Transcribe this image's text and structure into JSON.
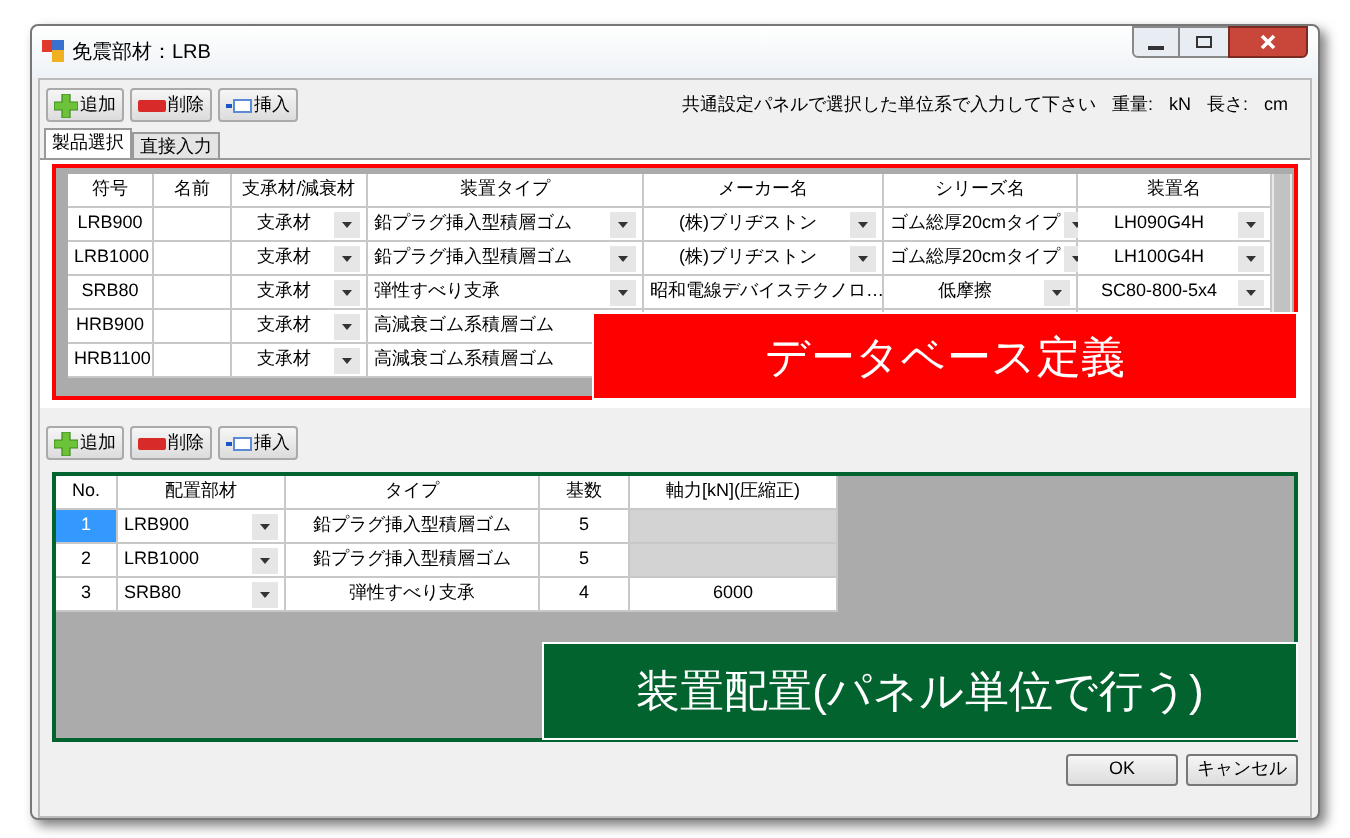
{
  "window": {
    "title": "免震部材：LRB"
  },
  "toolbar_top": {
    "buttons": [
      {
        "kind": "add",
        "label": "追加"
      },
      {
        "kind": "delete",
        "label": "削除"
      },
      {
        "kind": "insert",
        "label": "挿入"
      }
    ],
    "hint": "共通設定パネルで選択した単位系で入力して下さい",
    "units": [
      {
        "label": "重量:",
        "value": "kN"
      },
      {
        "label": "長さ:",
        "value": "cm"
      }
    ]
  },
  "tabs": [
    {
      "label": "製品選択",
      "selected": true
    },
    {
      "label": "直接入力",
      "selected": false
    }
  ],
  "product_table": {
    "columns": [
      "符号",
      "名前",
      "支承材/減衰材",
      "装置タイプ",
      "メーカー名",
      "シリーズ名",
      "装置名"
    ],
    "rows": [
      {
        "symbol": "LRB900",
        "material": "支承材",
        "type": "鉛プラグ挿入型積層ゴム",
        "maker": "(株)ブリヂストン",
        "series": "ゴム総厚20cmタイプ",
        "device": "LH090G4H"
      },
      {
        "symbol": "LRB1000",
        "material": "支承材",
        "type": "鉛プラグ挿入型積層ゴム",
        "maker": "(株)ブリヂストン",
        "series": "ゴム総厚20cmタイプ",
        "device": "LH100G4H"
      },
      {
        "symbol": "SRB80",
        "material": "支承材",
        "type": "弾性すべり支承",
        "maker": "昭和電線デバイステクノロ…",
        "series": "低摩擦",
        "device": "SC80-800-5x4"
      },
      {
        "symbol": "HRB900",
        "material": "支承材",
        "type": "高減衰ゴム系積層ゴム"
      },
      {
        "symbol": "HRB1100",
        "material": "支承材",
        "type": "高減衰ゴム系積層ゴム"
      }
    ],
    "callout": "データベース定義"
  },
  "toolbar_bottom": {
    "buttons": [
      {
        "kind": "add",
        "label": "追加"
      },
      {
        "kind": "delete",
        "label": "削除"
      },
      {
        "kind": "insert",
        "label": "挿入"
      }
    ]
  },
  "placement_table": {
    "columns": [
      "No.",
      "配置部材",
      "タイプ",
      "基数",
      "軸力[kN](圧縮正)"
    ],
    "rows": [
      {
        "no": "1",
        "member": "LRB900",
        "type": "鉛プラグ挿入型積層ゴム",
        "count": "5",
        "axial_enabled": false,
        "selected": true
      },
      {
        "no": "2",
        "member": "LRB1000",
        "type": "鉛プラグ挿入型積層ゴム",
        "count": "5",
        "axial_enabled": false,
        "selected": false
      },
      {
        "no": "3",
        "member": "SRB80",
        "type": "弾性すべり支承",
        "count": "4",
        "axial": "6000",
        "axial_enabled": true,
        "selected": false
      }
    ],
    "callout": "装置配置(パネル単位で行う)"
  },
  "buttons": [
    "OK",
    "キャンセル"
  ]
}
